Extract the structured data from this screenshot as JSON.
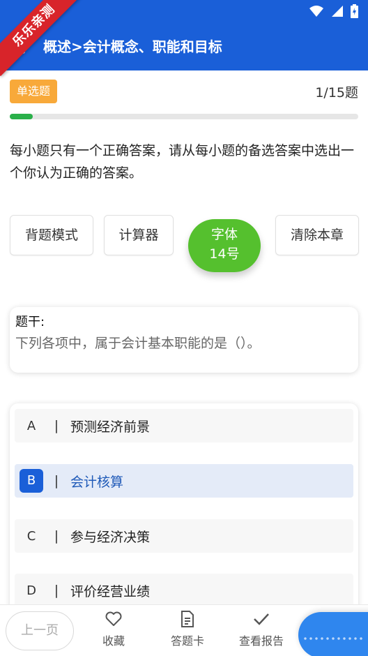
{
  "header": {
    "title": "概述>会计概念、职能和目标",
    "ribbon": "乐乐亲测"
  },
  "question": {
    "type_badge": "单选题",
    "progress_label": "1/15题",
    "progress_fraction": 0.0667,
    "instructions": "每小题只有一个正确答案，请从每小题的备选答案中选出一个你认为正确的答案。",
    "stem_label": "题干:",
    "stem_text": "下列各项中，属于会计基本职能的是（）。"
  },
  "tools": {
    "recite_mode": "背题模式",
    "calculator": "计算器",
    "font_line1": "字体",
    "font_line2": "14号",
    "clear_chapter": "清除本章"
  },
  "options": [
    {
      "letter": "A",
      "sep": "|",
      "text": "预测经济前景",
      "selected": false
    },
    {
      "letter": "B",
      "sep": "|",
      "text": "会计核算",
      "selected": true
    },
    {
      "letter": "C",
      "sep": "|",
      "text": "参与经济决策",
      "selected": false
    },
    {
      "letter": "D",
      "sep": "|",
      "text": "评价经营业绩",
      "selected": false
    }
  ],
  "bottom": {
    "prev": "上一页",
    "favorite": "收藏",
    "answer_card": "答题卡",
    "report": "查看报告"
  },
  "colors": {
    "primary": "#1a5fd8",
    "badge": "#f8a93a",
    "progress": "#2ab04a",
    "font_button": "#55c02e",
    "ribbon": "#d8242a"
  }
}
